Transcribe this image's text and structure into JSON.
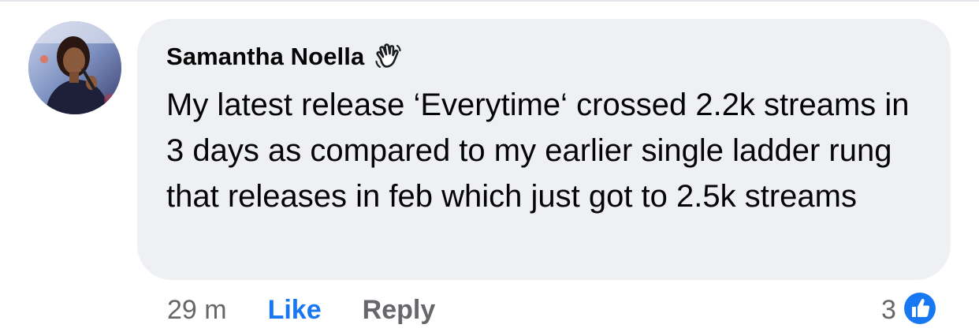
{
  "comment": {
    "author": "Samantha Noella",
    "author_badge_icon": "waving-hand-icon",
    "text": "My latest release ‘Everytime‘ crossed 2.2k streams in 3 days as compared to my earlier single ladder rung that releases in feb which just got to 2.5k streams",
    "timestamp": "29 m",
    "like_label": "Like",
    "reply_label": "Reply",
    "reaction_count": "3",
    "reaction_icon": "thumbs-up-icon"
  },
  "colors": {
    "bubble": "#eff0f4",
    "text": "#050505",
    "muted": "#65676b",
    "accent": "#1877f2"
  }
}
